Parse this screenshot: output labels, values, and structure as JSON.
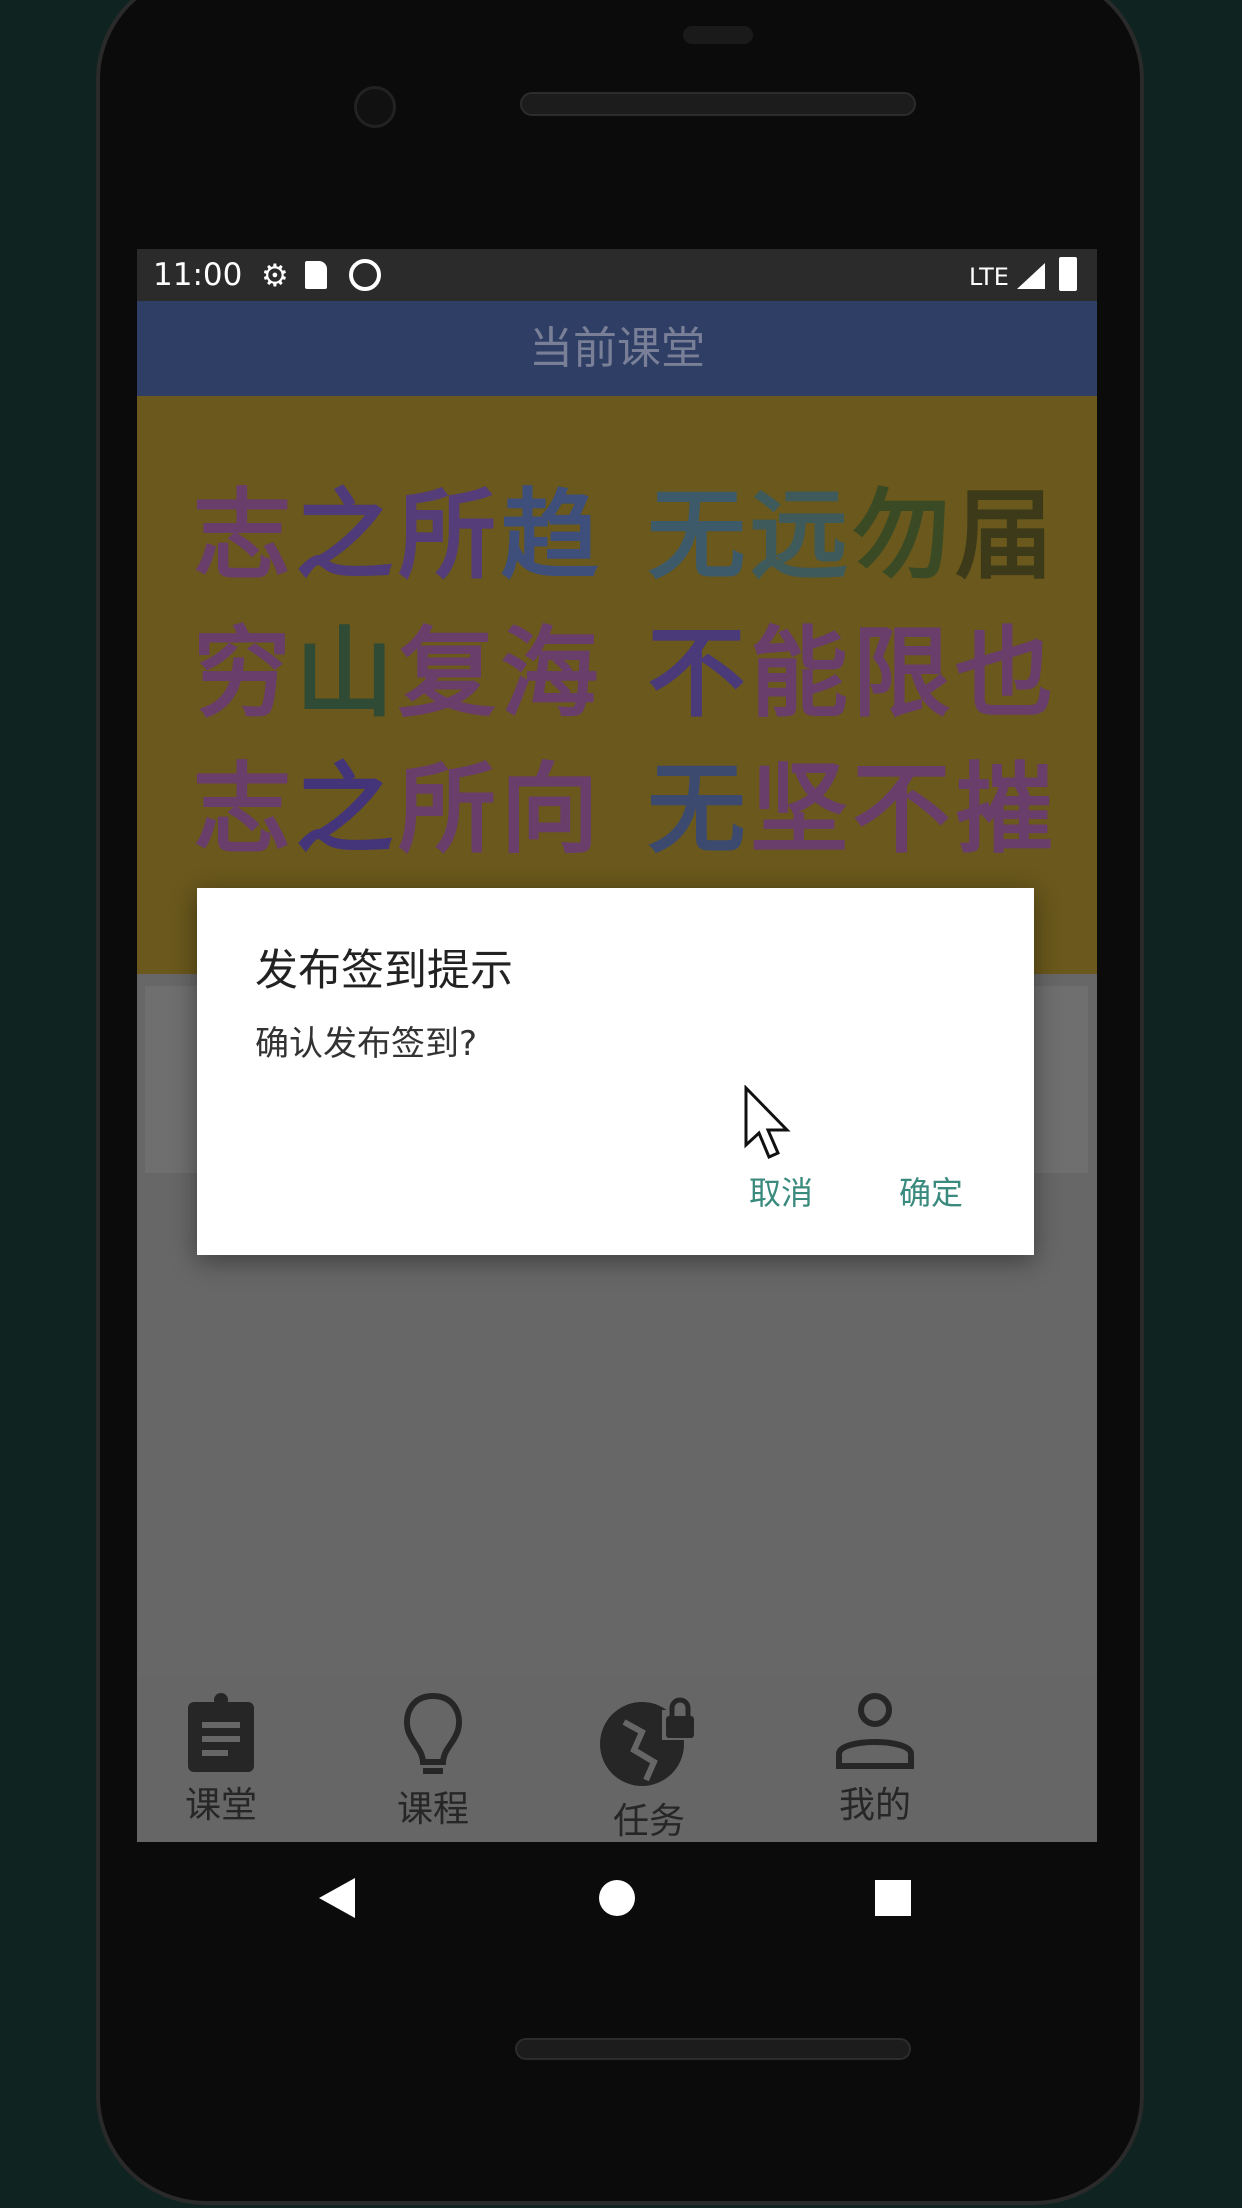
{
  "status_bar": {
    "time": "11:00",
    "network": "LTE"
  },
  "app_bar": {
    "title": "当前课堂"
  },
  "banner": {
    "rows": [
      [
        "志",
        "之",
        "所",
        "趋",
        "无",
        "远",
        "勿",
        "届"
      ],
      [
        "穷",
        "山",
        "复",
        "海",
        "不",
        "能",
        "限",
        "也"
      ],
      [
        "志",
        "之",
        "所",
        "向",
        "无",
        "坚",
        "不",
        "摧"
      ]
    ],
    "colors": [
      [
        "#6a3e6a",
        "#4f3a7a",
        "#553d7a",
        "#3d4f7a",
        "#3d5a6a",
        "#3f5a5a",
        "#3a4a25",
        "#3d3a1a"
      ],
      [
        "#6a3e6a",
        "#2f4a35",
        "#6a3e6a",
        "#6a3e6a",
        "#4a3a7a",
        "#6a3e6a",
        "#6a3e6a",
        "#6a3e6a"
      ],
      [
        "#6a3e6a",
        "#44357a",
        "#6a3e6a",
        "#6a3e6a",
        "#3d4a70",
        "#6a3e6a",
        "#6a3e6a",
        "#6a3e6a"
      ]
    ]
  },
  "dialog": {
    "title": "发布签到提示",
    "message": "确认发布签到?",
    "cancel": "取消",
    "confirm": "确定",
    "button_color": "#3b8a7e"
  },
  "bottom_nav": [
    {
      "label": "课堂",
      "icon": "clipboard-icon"
    },
    {
      "label": "课程",
      "icon": "lightbulb-icon"
    },
    {
      "label": "任务",
      "icon": "globe-lock-icon"
    },
    {
      "label": "我的",
      "icon": "person-icon"
    }
  ]
}
